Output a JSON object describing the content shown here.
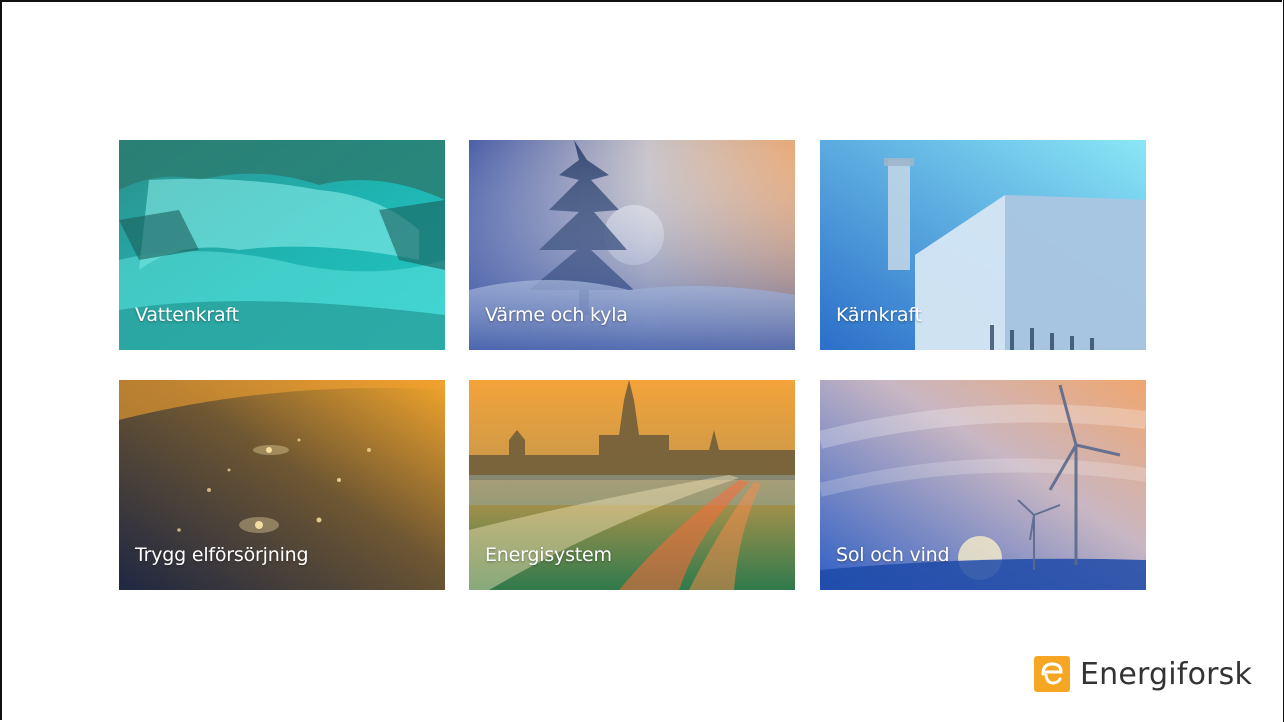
{
  "tiles": [
    {
      "label": "Vattenkraft"
    },
    {
      "label": "Värme och kyla"
    },
    {
      "label": "Kärnkraft"
    },
    {
      "label": "Trygg elförsörjning"
    },
    {
      "label": "Energisystem"
    },
    {
      "label": "Sol och vind"
    }
  ],
  "logo": {
    "text": "Energiforsk",
    "icon": "energiforsk-logo-icon",
    "color": "#f5a623"
  },
  "colors": {
    "waterfall": "#1fa6a8",
    "winter": "#2f4f9e",
    "nuclear": "#4f9fdb",
    "earth": "#f09a2a",
    "city": "#e9a233",
    "wind": "#e6a779"
  }
}
